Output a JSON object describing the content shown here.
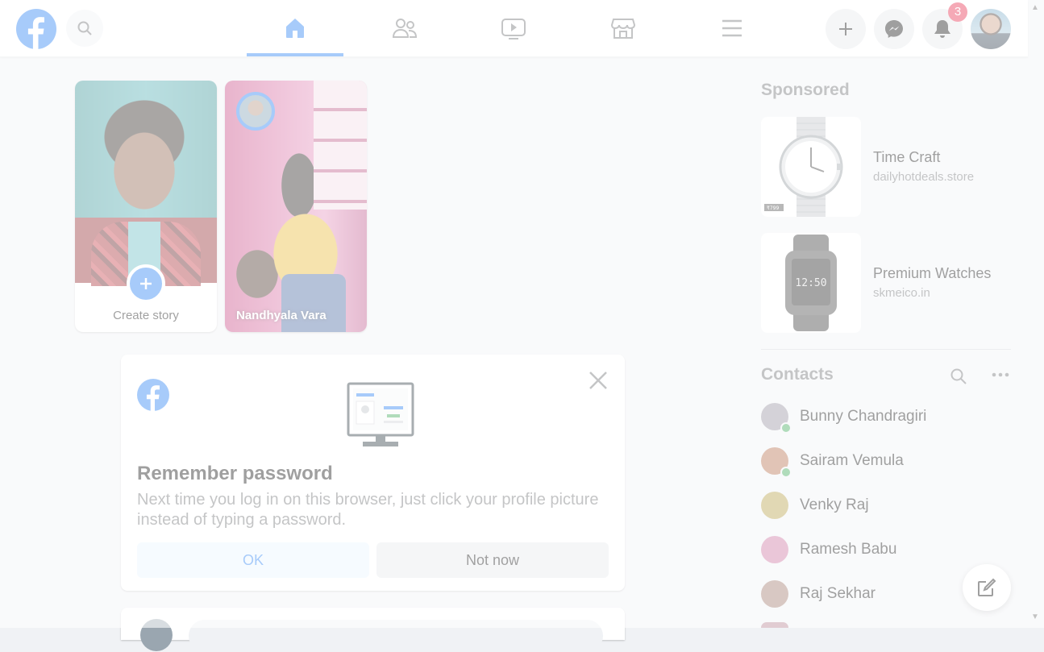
{
  "header": {
    "notification_count": "3",
    "tabs": [
      "home",
      "friends",
      "watch",
      "marketplace",
      "menu"
    ],
    "active_tab": "home"
  },
  "stories": {
    "create_label": "Create story",
    "items": [
      {
        "name": "Nandhyala Vara"
      }
    ]
  },
  "remember_password": {
    "title": "Remember password",
    "text": "Next time you log in on this browser, just click your profile picture instead of typing a password.",
    "ok_label": "OK",
    "not_now_label": "Not now"
  },
  "sponsored": {
    "title": "Sponsored",
    "ads": [
      {
        "title": "Time Craft",
        "domain": "dailyhotdeals.store",
        "price_tag": "₹799"
      },
      {
        "title": "Premium Watches",
        "domain": "skmeico.in",
        "display": "12:50"
      }
    ]
  },
  "contacts": {
    "title": "Contacts",
    "items": [
      {
        "name": "Bunny Chandragiri",
        "online": true,
        "color": "#8e8a98"
      },
      {
        "name": "Sairam Vemula",
        "online": true,
        "color": "#b0653f"
      },
      {
        "name": "Venky Raj",
        "online": false,
        "color": "#b19a3a"
      },
      {
        "name": "Ramesh Babu",
        "online": false,
        "color": "#c86a9a"
      },
      {
        "name": "Raj Sekhar",
        "online": false,
        "color": "#9a6f62"
      }
    ]
  },
  "colors": {
    "brand": "#1877f2",
    "badge": "#e41e3f",
    "online": "#31a24c"
  }
}
